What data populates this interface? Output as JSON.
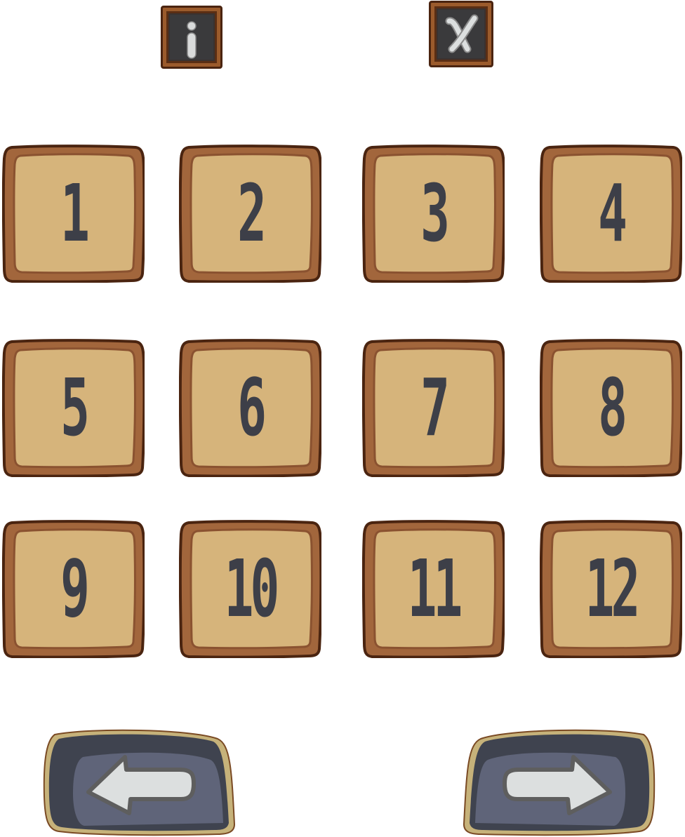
{
  "toolbar": {
    "info_icon": "info-icon",
    "close_icon": "close-icon"
  },
  "levels": [
    "1",
    "2",
    "3",
    "4",
    "5",
    "6",
    "7",
    "8",
    "9",
    "10",
    "11",
    "12"
  ],
  "navigation": {
    "prev_icon": "arrow-left-icon",
    "next_icon": "arrow-right-icon"
  },
  "colors": {
    "tile_face": "#d6b47b",
    "tile_rim": "#a2663c",
    "tile_outline": "#4a2410",
    "digit": "#3d3f48",
    "nav_dark": "#3f434f",
    "nav_inner": "#5f6479",
    "nav_rim": "#c6b27a",
    "arrow_fill": "#dcdfdf"
  }
}
